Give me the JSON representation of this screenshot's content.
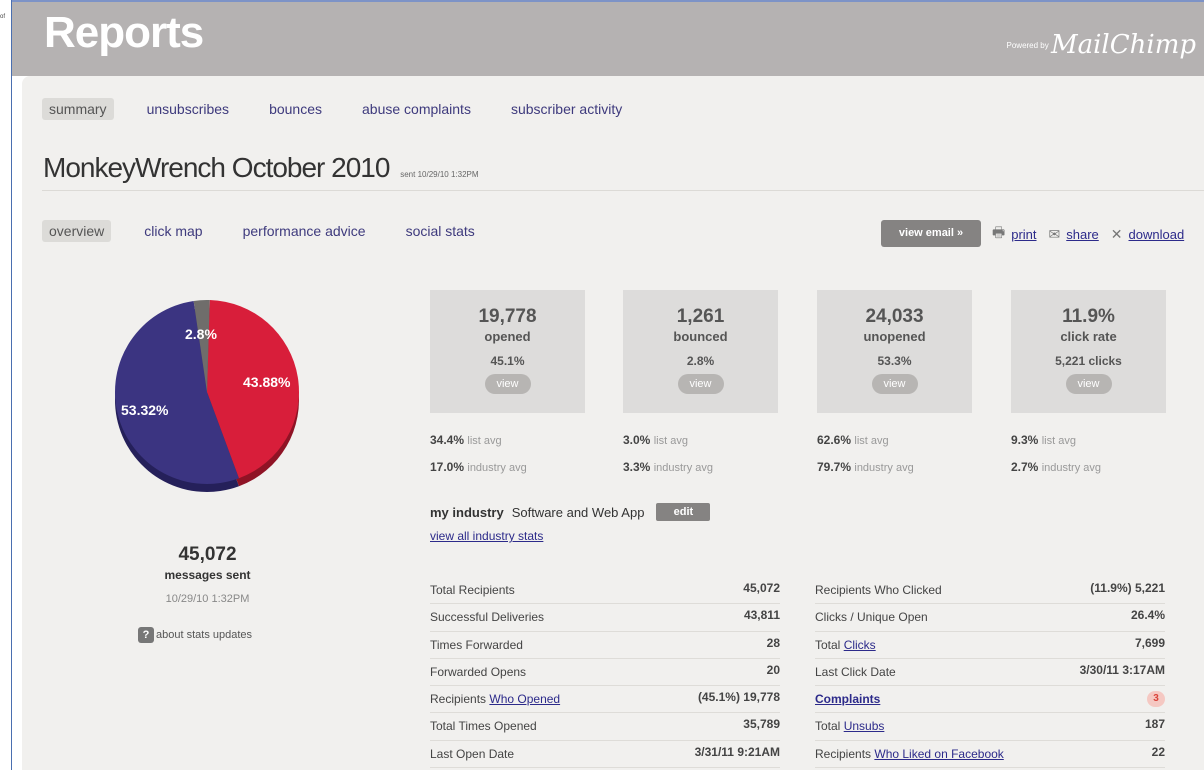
{
  "edge_text": "of",
  "header": {
    "title": "Reports",
    "powered_by": "Powered by",
    "brand": "MailChimp"
  },
  "tabs_top": [
    "summary",
    "unsubscribes",
    "bounces",
    "abuse complaints",
    "subscriber activity"
  ],
  "campaign": {
    "name": "MonkeyWrench October 2010",
    "sent": "sent 10/29/10 1:32PM"
  },
  "tabs_sub": [
    "overview",
    "click map",
    "performance advice",
    "social stats"
  ],
  "toolbar": {
    "view_email": "view email »",
    "print": "print",
    "share": "share",
    "download": "download"
  },
  "pie": {
    "slices": [
      {
        "label": "43.88%",
        "value": 43.88,
        "color": "#d81e3a"
      },
      {
        "label": "53.32%",
        "value": 53.32,
        "color": "#3b3481"
      },
      {
        "label": "2.8%",
        "value": 2.8,
        "color": "#6f6d6b"
      }
    ]
  },
  "summary": {
    "sent_count": "45,072",
    "sent_label": "messages sent",
    "sent_date": "10/29/10 1:32PM",
    "about": "about stats updates"
  },
  "stats": [
    {
      "num": "19,778",
      "label": "opened",
      "pct": "45.1%",
      "view": "view",
      "list_avg": "34.4%",
      "industry_avg": "17.0%"
    },
    {
      "num": "1,261",
      "label": "bounced",
      "pct": "2.8%",
      "view": "view",
      "list_avg": "3.0%",
      "industry_avg": "3.3%"
    },
    {
      "num": "24,033",
      "label": "unopened",
      "pct": "53.3%",
      "view": "view",
      "list_avg": "62.6%",
      "industry_avg": "79.7%"
    },
    {
      "num": "11.9%",
      "label": "click rate",
      "pct": "5,221 clicks",
      "view": "view",
      "list_avg": "9.3%",
      "industry_avg": "2.7%"
    }
  ],
  "avg_labels": {
    "list": "list avg",
    "industry": "industry avg"
  },
  "industry": {
    "label": "my industry",
    "value": "Software and Web App",
    "edit": "edit",
    "view_all": "view all industry stats"
  },
  "table_left": [
    {
      "pre": "Total Recipients",
      "link": "",
      "value": "45,072"
    },
    {
      "pre": "Successful Deliveries",
      "link": "",
      "value": "43,811"
    },
    {
      "pre": "Times Forwarded",
      "link": "",
      "value": "28"
    },
    {
      "pre": "Forwarded Opens",
      "link": "",
      "value": "20"
    },
    {
      "pre": "Recipients ",
      "link": "Who Opened",
      "value": "(45.1%) 19,778"
    },
    {
      "pre": "Total Times Opened",
      "link": "",
      "value": "35,789"
    },
    {
      "pre": "Last Open Date",
      "link": "",
      "value": "3/31/11 9:21AM"
    }
  ],
  "table_right": [
    {
      "pre": "Recipients Who Clicked",
      "link": "",
      "value": "(11.9%) 5,221"
    },
    {
      "pre": "Clicks / Unique Open",
      "link": "",
      "value": "26.4%"
    },
    {
      "pre": "Total ",
      "link": "Clicks",
      "value": "7,699"
    },
    {
      "pre": "Last Click Date",
      "link": "",
      "value": "3/30/11 3:17AM"
    },
    {
      "pre": "",
      "link": "Complaints",
      "value": "3"
    },
    {
      "pre": "Total ",
      "link": "Unsubs",
      "value": "187"
    },
    {
      "pre": "Recipients ",
      "link": "Who Liked on Facebook",
      "value": "22"
    }
  ]
}
